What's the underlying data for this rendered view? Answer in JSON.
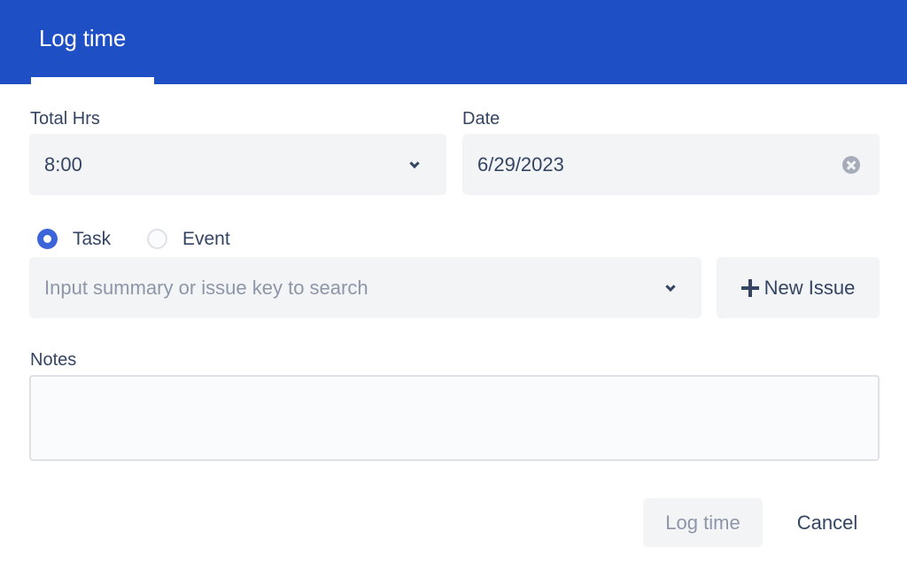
{
  "header": {
    "title": "Log time",
    "accent_color": "#1f4fc5"
  },
  "form": {
    "total_hrs": {
      "label": "Total Hrs",
      "value": "8:00",
      "icon": "chevron-down-icon"
    },
    "date": {
      "label": "Date",
      "value": "6/29/2023",
      "icon": "clear-icon"
    },
    "type_radio": {
      "options": [
        {
          "label": "Task",
          "checked": true
        },
        {
          "label": "Event",
          "checked": false
        }
      ]
    },
    "issue_search": {
      "placeholder": "Input summary or issue key to search",
      "value": "",
      "icon": "chevron-down-icon"
    },
    "new_issue_button": {
      "label": "New Issue",
      "icon": "plus-icon"
    },
    "notes": {
      "label": "Notes",
      "value": ""
    }
  },
  "footer": {
    "log_time_label": "Log time",
    "log_time_disabled": true,
    "cancel_label": "Cancel"
  }
}
